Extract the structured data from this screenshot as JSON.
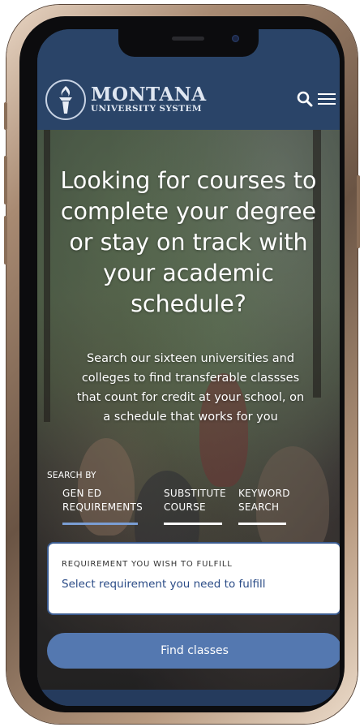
{
  "header": {
    "logo_title": "MONTANA",
    "logo_subtitle": "UNIVERSITY SYSTEM"
  },
  "icons": {
    "search": "search-icon",
    "menu": "hamburger-menu-icon",
    "logo": "torch-icon"
  },
  "hero": {
    "headline": "Looking for courses to complete your degree or stay on track with your academic schedule?",
    "subhead": "Search our sixteen universities and colleges to find transferable classses that count for credit at your school, on a schedule that works for you"
  },
  "search": {
    "search_by_label": "SEARCH BY",
    "tabs": [
      {
        "line1": "GEN ED",
        "line2": "REQUIREMENTS",
        "active": true
      },
      {
        "line1": "SUBSTITUTE",
        "line2": "COURSE",
        "active": false
      },
      {
        "line1": "KEYWORD",
        "line2": "SEARCH",
        "active": false
      }
    ],
    "requirement_label": "REQUIREMENT YOU WISH TO FULFILL",
    "requirement_placeholder": "Select requirement you need to fulfill",
    "find_button": "Find classes"
  },
  "colors": {
    "header_bg": "#2a4468",
    "active_tab": "#7a9ed4",
    "button_bg": "#5478b0",
    "select_text": "#2a4b86"
  }
}
